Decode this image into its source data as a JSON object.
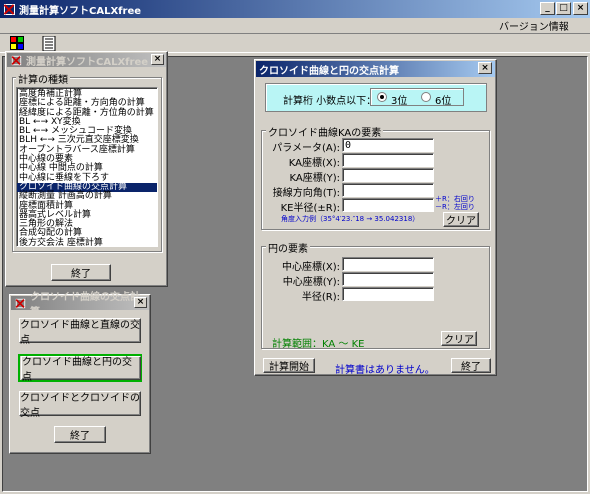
{
  "app": {
    "title": "測量計算ソフトCALXfree",
    "menu_version": "バージョン情報",
    "window_controls": [
      "_",
      "□",
      "×"
    ]
  },
  "toolbar": {
    "icons": [
      "calculator-icon",
      "document-icon"
    ]
  },
  "main_menu_window": {
    "title": "測量計算ソフトCALXfree",
    "group_label": "計算の種類",
    "items": [
      "高度角補正計算",
      "座標による距離・方向角の計算",
      "経緯度による距離・方位角の計算",
      "BL ←→ XY変換",
      "BL ←→ メッシュコード変換",
      "BLH ←→ 三次元直交座標変換",
      "オープントラバース座標計算",
      "中心線の要素",
      "中心線 中間点の計算",
      "中心線に垂線を下ろす",
      "クロソイド曲線の交点計算",
      "縦断測量 計画高の計算",
      "座標面積計算",
      "器高式レベル計算",
      "三角形の解法",
      "合成勾配の計算",
      "後方交会法 座標計算"
    ],
    "selected_index": 10,
    "close_label": "終了"
  },
  "clothoid_menu_window": {
    "title": "クロソイド曲線の交点計算",
    "buttons": [
      "クロソイド曲線と直線の交点",
      "クロソイド曲線と円の交点",
      "クロソイドとクロソイドの交点"
    ],
    "active_index": 1,
    "close_label": "終了"
  },
  "calc_window": {
    "title": "クロソイド曲線と円の交点計算",
    "precision": {
      "label": "計算桁 小数点以下：",
      "options": [
        "3位",
        "6位"
      ],
      "selected": "3位"
    },
    "clothoid_group": {
      "label": "クロソイド曲線KAの要素",
      "fields": [
        {
          "label": "パラメータ(A):",
          "value": "0"
        },
        {
          "label": "KA座標(X):",
          "value": ""
        },
        {
          "label": "KA座標(Y):",
          "value": ""
        },
        {
          "label": "接線方向角(T):",
          "value": ""
        },
        {
          "label": "KE半径(±R):",
          "value": ""
        }
      ],
      "hint_plus": "＋R：右回り",
      "hint_minus": "－R：左回り",
      "angle_example": "角度入力例（35°4′23.″18 → 35.042318）",
      "clear_label": "クリア"
    },
    "circle_group": {
      "label": "円の要素",
      "fields": [
        {
          "label": "中心座標(X):",
          "value": ""
        },
        {
          "label": "中心座標(Y):",
          "value": ""
        },
        {
          "label": "半径(R):",
          "value": ""
        }
      ],
      "range_text": "計算範囲：KA ～ KE",
      "clear_label": "クリア"
    },
    "start_label": "計算開始",
    "status": "計算書はありません。",
    "close_label": "終了"
  },
  "colors": {
    "desktop": "#808080",
    "face": "#d4d0c8",
    "title_active": "#0a246a",
    "precision_bg": "#b9f5f5",
    "hint_blue": "#0000cc",
    "range_green": "#008000",
    "status_blue": "#0000cc",
    "highlight_green": "#00b000"
  }
}
